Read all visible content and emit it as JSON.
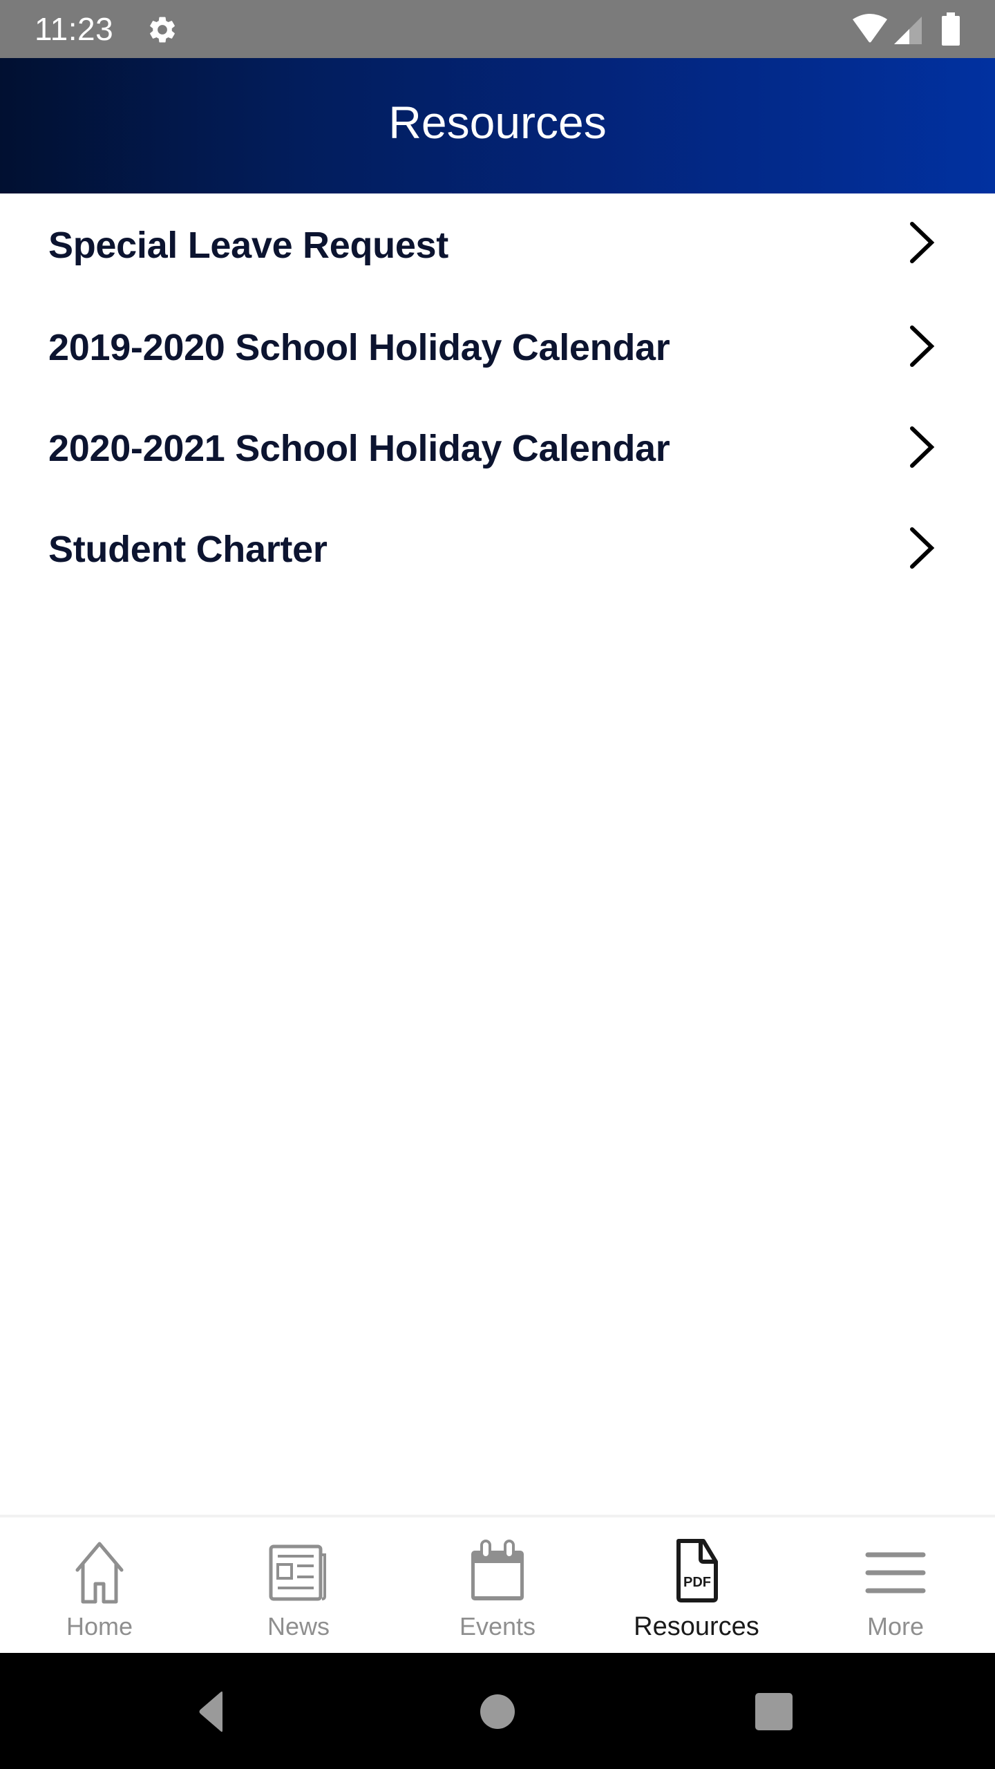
{
  "status_bar": {
    "time": "11:23",
    "icons": [
      "settings-gear-icon",
      "wifi-icon",
      "cell-signal-icon",
      "battery-icon"
    ]
  },
  "header": {
    "title": "Resources",
    "gradient_colors": [
      "#011031",
      "#0131a0"
    ]
  },
  "resources": {
    "items": [
      {
        "label": "Special Leave Request",
        "icon": "chevron-right-icon"
      },
      {
        "label": "2019-2020 School Holiday Calendar",
        "icon": "chevron-right-icon"
      },
      {
        "label": "2020-2021 School Holiday Calendar",
        "icon": "chevron-right-icon"
      },
      {
        "label": "Student Charter",
        "icon": "chevron-right-icon"
      }
    ],
    "text_color": "#0c1430"
  },
  "bottom_nav": {
    "items": [
      {
        "label": "Home",
        "icon": "home-icon",
        "active": false
      },
      {
        "label": "News",
        "icon": "newspaper-icon",
        "active": false
      },
      {
        "label": "Events",
        "icon": "calendar-icon",
        "active": false
      },
      {
        "label": "Resources",
        "icon": "pdf-file-icon",
        "active": true
      },
      {
        "label": "More",
        "icon": "hamburger-menu-icon",
        "active": false
      }
    ],
    "inactive_color": "#8f8f8f",
    "active_color": "#1a1a1a"
  },
  "system_nav": {
    "buttons": [
      "back",
      "home",
      "recents"
    ]
  }
}
